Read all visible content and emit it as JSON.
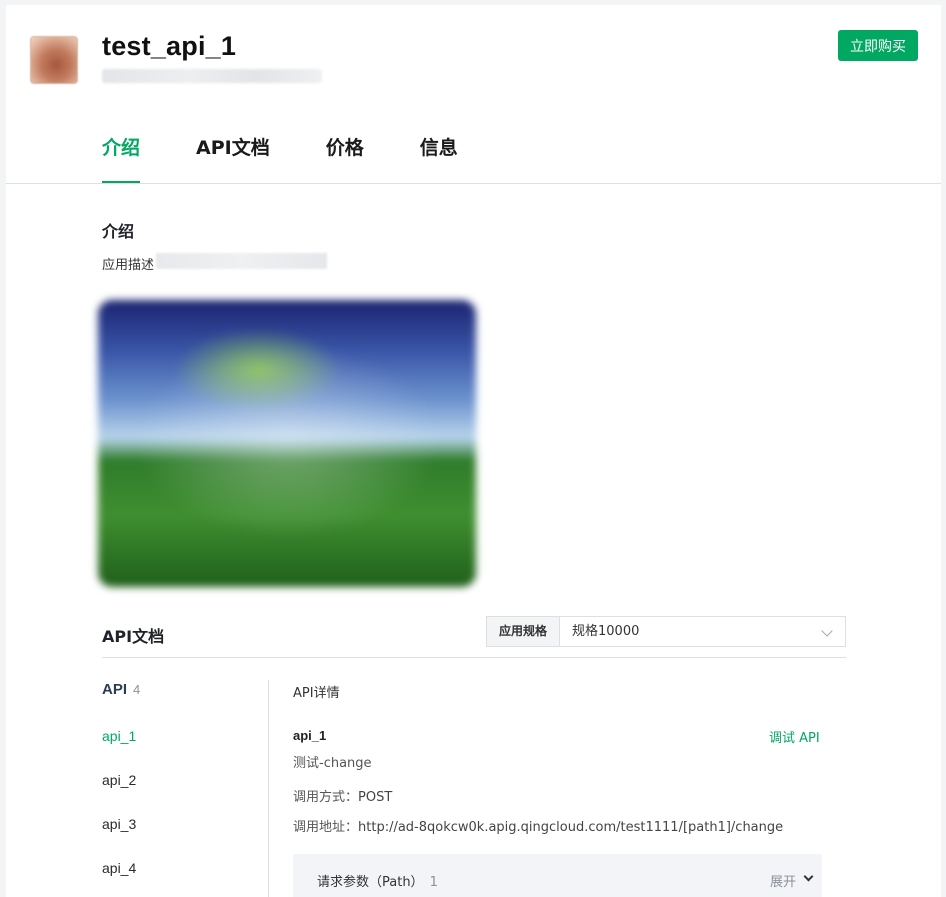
{
  "header": {
    "app_title": "test_api_1",
    "buy_label": "立即购买"
  },
  "tabs": [
    {
      "label": "介绍"
    },
    {
      "label": "API文档"
    },
    {
      "label": "价格"
    },
    {
      "label": "信息"
    }
  ],
  "intro": {
    "title": "介绍",
    "description_label": "应用描述"
  },
  "api_doc": {
    "title": "API文档",
    "spec_label": "应用规格",
    "spec_value": "规格10000",
    "list_title": "API",
    "list_count": "4",
    "items": [
      {
        "label": "api_1"
      },
      {
        "label": "api_2"
      },
      {
        "label": "api_3"
      },
      {
        "label": "api_4"
      }
    ]
  },
  "detail": {
    "section_title": "API详情",
    "name": "api_1",
    "debug_label": "调试 API",
    "description": "测试-change",
    "method_label": "调用方式：",
    "method_value": "POST",
    "address_label": "调用地址：",
    "address_value": "http://ad-8qokcw0k.apig.qingcloud.com/test1111/[path1]/change",
    "param_title": "请求参数（Path）",
    "param_count": "1",
    "param_expand": "展开"
  },
  "colors": {
    "accent": "#00a862",
    "background": "#f2f4f5"
  }
}
